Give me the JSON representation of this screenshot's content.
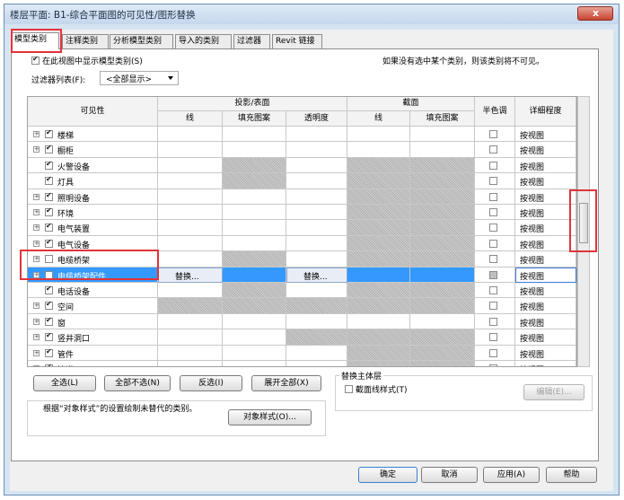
{
  "window": {
    "title": "楼层平面: B1-综合平面图的可见性/图形替换"
  },
  "tabs": [
    "模型类别",
    "注释类别",
    "分析模型类别",
    "导入的类别",
    "过滤器",
    "Revit 链接"
  ],
  "options": {
    "show_model_label": "在此视图中显示模型类别(S)",
    "show_model_checked": true,
    "hint": "如果没有选中某个类别，则该类别将不可见。",
    "filter_label": "过滤器列表(F):",
    "filter_value": "<全部显示>"
  },
  "table": {
    "h_visibility": "可见性",
    "h_projection": "投影/表面",
    "h_section": "截面",
    "h_halftone": "半色调",
    "h_detail": "详细程度",
    "h_line": "线",
    "h_fill": "填充图案",
    "h_transparency": "透明度",
    "h_sec_line": "线",
    "h_sec_fill": "填充图案",
    "rows": [
      {
        "name": "楼梯",
        "checked": true,
        "exp": true,
        "detail": "按视图"
      },
      {
        "name": "橱柜",
        "checked": true,
        "exp": true,
        "detail": "按视图"
      },
      {
        "name": "火警设备",
        "checked": true,
        "exp": false,
        "detail": "按视图"
      },
      {
        "name": "灯具",
        "checked": true,
        "exp": false,
        "detail": "按视图"
      },
      {
        "name": "照明设备",
        "checked": true,
        "exp": true,
        "detail": "按视图"
      },
      {
        "name": "环境",
        "checked": true,
        "exp": true,
        "detail": "按视图"
      },
      {
        "name": "电气装置",
        "checked": true,
        "exp": true,
        "detail": "按视图"
      },
      {
        "name": "电气设备",
        "checked": true,
        "exp": true,
        "detail": "按视图"
      },
      {
        "name": "电缆桥架",
        "checked": false,
        "exp": true,
        "detail": "按视图"
      },
      {
        "name": "电缆桥架配件",
        "checked": false,
        "exp": true,
        "detail": "按视图",
        "selected": true,
        "override": "替换..."
      },
      {
        "name": "电话设备",
        "checked": true,
        "exp": false,
        "detail": "按视图"
      },
      {
        "name": "空间",
        "checked": true,
        "exp": true,
        "detail": "按视图"
      },
      {
        "name": "窗",
        "checked": true,
        "exp": true,
        "detail": "按视图"
      },
      {
        "name": "竖井洞口",
        "checked": true,
        "exp": true,
        "detail": "按视图"
      },
      {
        "name": "管件",
        "checked": true,
        "exp": true,
        "detail": "按视图"
      },
      {
        "name": "管道",
        "checked": true,
        "exp": true,
        "detail": "按视图"
      }
    ]
  },
  "buttons": {
    "select_all": "全选(L)",
    "select_none": "全部不选(N)",
    "invert": "反选(I)",
    "expand_all": "展开全部(X)",
    "host_layers": "替换主体层",
    "cut_line_styles": "截面线样式(T)",
    "edit": "编辑(E)...",
    "object_styles_note": "根据“对象样式”的设置绘制未替代的类别。",
    "object_styles": "对象样式(O)...",
    "ok": "确定",
    "cancel": "取消",
    "apply": "应用(A)",
    "help": "帮助"
  }
}
